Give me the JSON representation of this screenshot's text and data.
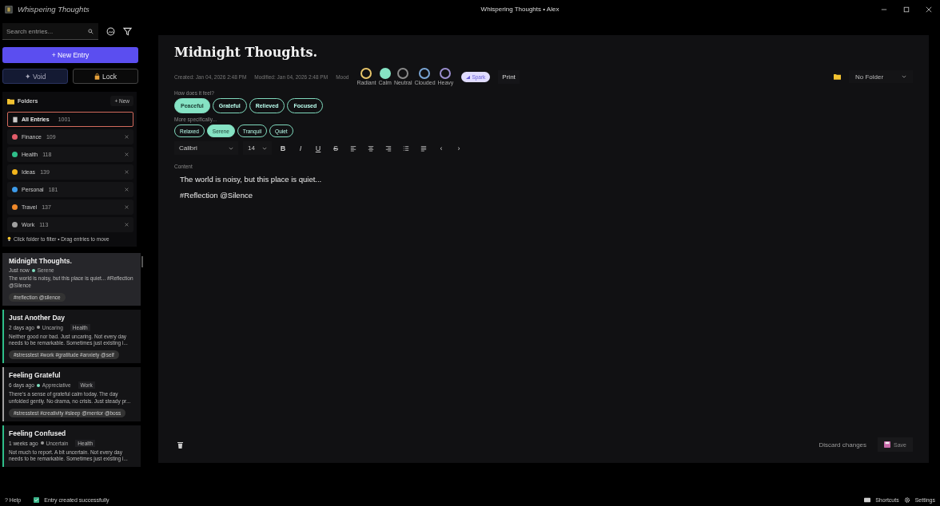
{
  "window": {
    "app_name": "Whispering Thoughts",
    "title": "Whispering Thoughts • Alex"
  },
  "sidebar": {
    "search": {
      "placeholder": "Search entries..."
    },
    "new_entry": "+ New Entry",
    "modes": [
      {
        "label": "✦ Void",
        "kind": "void",
        "selected": true
      },
      {
        "label": "Lock",
        "kind": "lock",
        "selected": false
      }
    ],
    "folders": {
      "title": "Folders",
      "new_button": "+ New",
      "all": {
        "label": "All Entries",
        "count": "1001",
        "selected": true
      },
      "items": [
        {
          "name": "Finance",
          "count": "109",
          "color": "#e35d6a"
        },
        {
          "name": "Health",
          "count": "118",
          "color": "#2fbf8a"
        },
        {
          "name": "Ideas",
          "count": "139",
          "color": "#f2b51c"
        },
        {
          "name": "Personal",
          "count": "181",
          "color": "#3d9bea"
        },
        {
          "name": "Travel",
          "count": "137",
          "color": "#f0892a"
        },
        {
          "name": "Work",
          "count": "113",
          "color": "#a0a0a0"
        }
      ],
      "hint": "Click folder to filter • Drag entries to move"
    },
    "entries": [
      {
        "title": "Midnight Thoughts.",
        "time": "Just now",
        "mood": {
          "label": "Serene",
          "color": "#7fe0c0"
        },
        "selected": true,
        "excerpt": "The world is noisy, but this place is quiet... #Reflection @Silence",
        "tags": "#reflection @silence"
      },
      {
        "title": "Just Another Day",
        "time": "2 days ago",
        "mood": {
          "label": "Uncaring",
          "color": "#9a9a9a"
        },
        "folder": {
          "name": "Health",
          "color": "#2fbf8a"
        },
        "selected": false,
        "excerpt": "Neither good nor bad. Just uncaring. Not every day needs to be remarkable. Sometimes just existing i...",
        "tags": "#stresstest #work #gratitude #anxiety @self"
      },
      {
        "title": "Feeling Grateful",
        "time": "6 days ago",
        "mood": {
          "label": "Appreciative",
          "color": "#7fe0c0"
        },
        "folder": {
          "name": "Work",
          "color": "#a0a0a0"
        },
        "selected": false,
        "excerpt": "There's a sense of grateful calm today. The day unfolded gently. No drama, no crisis. Just steady pr...",
        "tags": "#stresstest #creativity #sleep @mentor @boss"
      },
      {
        "title": "Feeling Confused",
        "time": "1 weeks ago",
        "mood": {
          "label": "Uncertain",
          "color": "#9a9a9a"
        },
        "folder": {
          "name": "Health",
          "color": "#2fbf8a"
        },
        "selected": false,
        "excerpt": "Not much to report. A bit uncertain. Not every day needs to be remarkable. Sometimes just existing i..."
      }
    ]
  },
  "editor": {
    "title": "Midnight Thoughts.",
    "created": "Created: Jan 04, 2026 2:48 PM",
    "modified": "Modified: Jan 04, 2026 2:48 PM",
    "mood_label": "Mood",
    "moods": [
      {
        "label": "Radiant",
        "color": "#e8c66a",
        "selected": false
      },
      {
        "label": "Calm",
        "color": "#86e3c4",
        "selected": true
      },
      {
        "label": "Neutral",
        "color": "#8a8a8a",
        "selected": false
      },
      {
        "label": "Clouded",
        "color": "#7aa6d6",
        "selected": false
      },
      {
        "label": "Heavy",
        "color": "#9c8fd0",
        "selected": false
      }
    ],
    "spark": "Spark",
    "print": "Print",
    "folder_select": "No Folder",
    "feel_prompt": "How does it feel?",
    "feelings": [
      {
        "label": "Peaceful",
        "selected": true
      },
      {
        "label": "Grateful",
        "selected": false
      },
      {
        "label": "Relieved",
        "selected": false
      },
      {
        "label": "Focused",
        "selected": false
      }
    ],
    "specific_prompt": "More specifically...",
    "specifics": [
      {
        "label": "Relaxed",
        "selected": false
      },
      {
        "label": "Serene",
        "selected": true
      },
      {
        "label": "Tranquil",
        "selected": false
      },
      {
        "label": "Quiet",
        "selected": false
      }
    ],
    "font": "Calibri",
    "size": "14",
    "toolbar": [
      {
        "kind": "bold",
        "label": "B"
      },
      {
        "kind": "italic",
        "label": "I"
      },
      {
        "kind": "underline",
        "label": "U"
      },
      {
        "kind": "strike",
        "label": "S"
      },
      {
        "kind": "align-left"
      },
      {
        "kind": "align-center"
      },
      {
        "kind": "align-right"
      },
      {
        "kind": "bullets"
      },
      {
        "kind": "justify"
      },
      {
        "kind": "prev",
        "label": "‹"
      },
      {
        "kind": "next",
        "label": "›"
      }
    ],
    "content_label": "Content",
    "content": [
      "The world is noisy, but this place is quiet...",
      "#Reflection @Silence"
    ],
    "discard": "Discard changes",
    "save": "Save"
  },
  "status_bar": {
    "help": "Help",
    "help_icon": "?",
    "message": "Entry created successfully",
    "shortcuts": "Shortcuts",
    "settings": "Settings"
  }
}
